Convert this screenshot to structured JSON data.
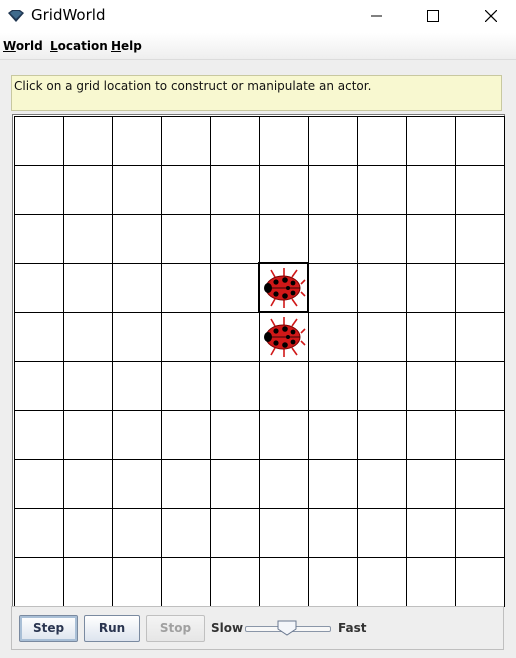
{
  "window": {
    "title": "GridWorld",
    "icon": "gridworld-diamond-icon",
    "controls": [
      "minimize-icon",
      "maximize-icon",
      "close-icon"
    ]
  },
  "menu": {
    "items": [
      {
        "label": "World",
        "mnemonic": "W",
        "rest": "orld"
      },
      {
        "label": "Location",
        "mnemonic": "L",
        "rest": "ocation"
      },
      {
        "label": "Help",
        "mnemonic": "H",
        "rest": "elp"
      }
    ]
  },
  "message": "Click on a grid location to construct or manipulate an actor.",
  "grid": {
    "rows": 10,
    "cols": 10,
    "selected": {
      "row": 3,
      "col": 5
    },
    "actors": [
      {
        "type": "Bug",
        "icon": "ladybug-icon",
        "row": 3,
        "col": 5,
        "direction": "east"
      },
      {
        "type": "Bug",
        "icon": "ladybug-icon",
        "row": 4,
        "col": 5,
        "direction": "east"
      }
    ]
  },
  "controls": {
    "step_label": "Step",
    "run_label": "Run",
    "stop_label": "Stop",
    "stop_enabled": false,
    "slow_label": "Slow",
    "fast_label": "Fast",
    "speed_fraction": 0.5
  },
  "colors": {
    "message_bg": "#f8f8d0",
    "bug_body": "#d01818",
    "bug_spots": "#000000"
  }
}
